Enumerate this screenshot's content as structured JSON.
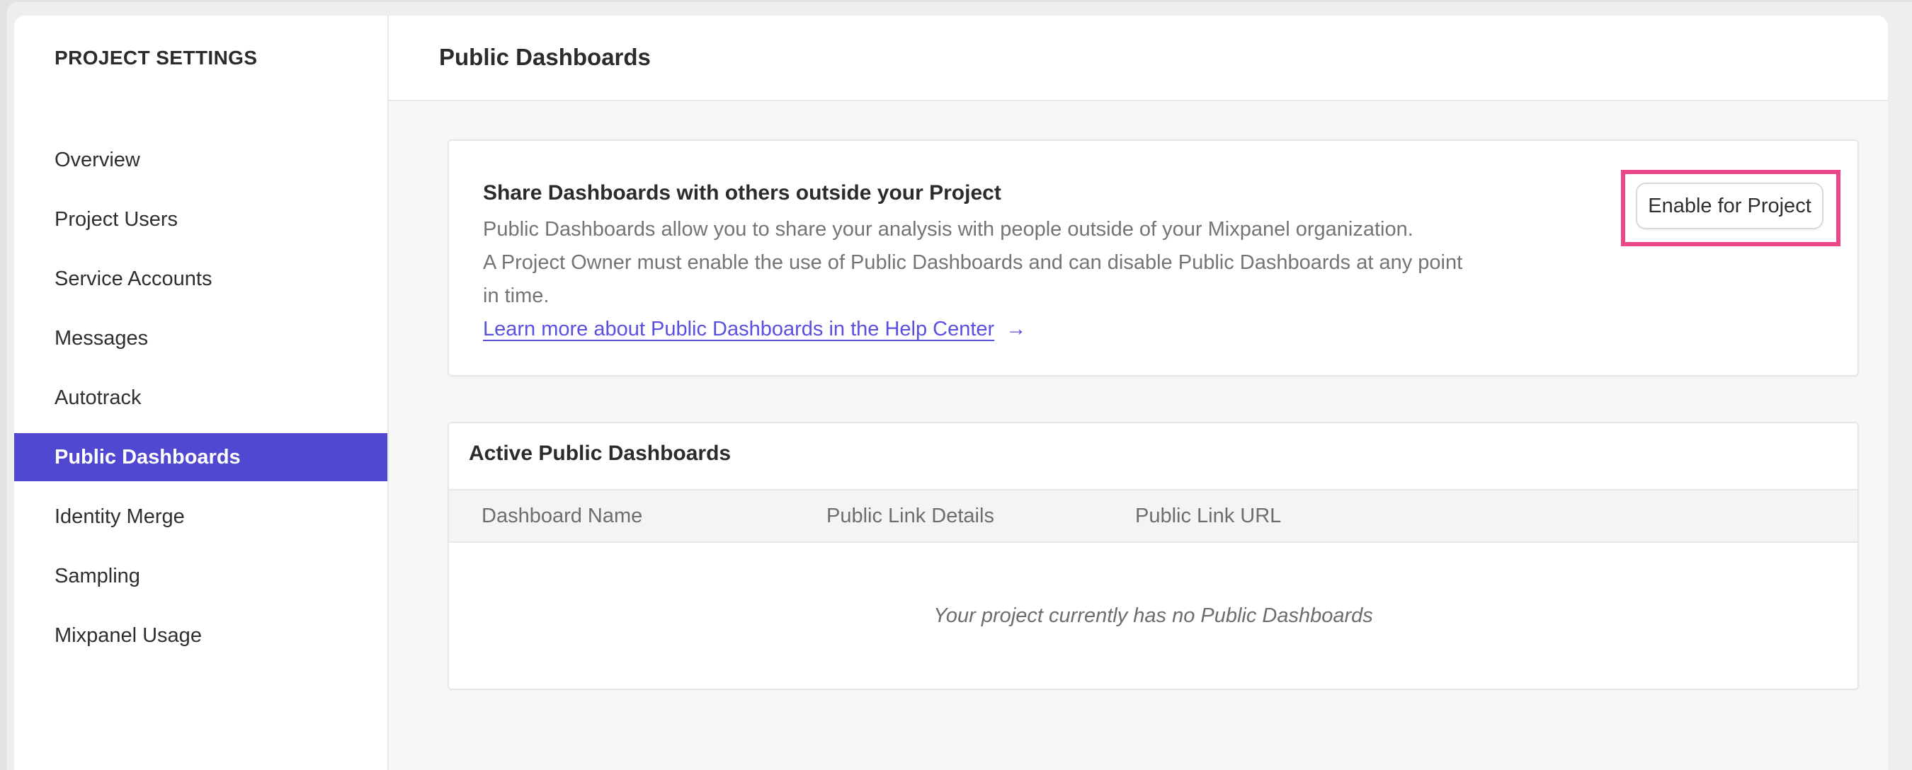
{
  "sidebar": {
    "title": "PROJECT SETTINGS",
    "items": [
      {
        "label": "Overview",
        "selected": false
      },
      {
        "label": "Project Users",
        "selected": false
      },
      {
        "label": "Service Accounts",
        "selected": false
      },
      {
        "label": "Messages",
        "selected": false
      },
      {
        "label": "Autotrack",
        "selected": false
      },
      {
        "label": "Public Dashboards",
        "selected": true
      },
      {
        "label": "Identity Merge",
        "selected": false
      },
      {
        "label": "Sampling",
        "selected": false
      },
      {
        "label": "Mixpanel Usage",
        "selected": false
      }
    ]
  },
  "header": {
    "title": "Public Dashboards"
  },
  "share_card": {
    "title": "Share Dashboards with others outside your Project",
    "body_line1": "Public Dashboards allow you to share your analysis with people outside of your Mixpanel organization.",
    "body_line2": "A Project Owner must enable the use of Public Dashboards and can disable Public Dashboards at any point",
    "body_line3": "in time.",
    "link_label": "Learn more about Public Dashboards in the Help Center",
    "link_arrow": "→",
    "enable_button_label": "Enable for Project"
  },
  "active_card": {
    "title": "Active Public Dashboards",
    "columns": [
      "Dashboard Name",
      "Public Link Details",
      "Public Link URL"
    ],
    "empty_message": "Your project currently has no Public Dashboards"
  },
  "colors": {
    "accent_purple": "#5048d0",
    "link_purple": "#5a50e0",
    "annotation_pink": "#ea4789"
  }
}
